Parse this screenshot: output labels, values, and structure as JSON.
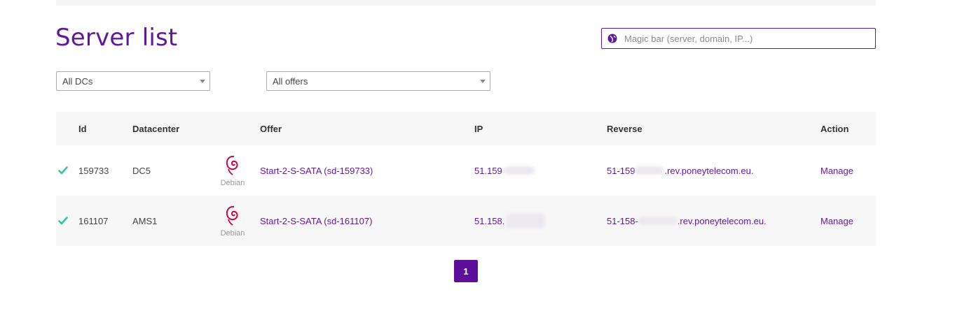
{
  "page": {
    "title": "Server list"
  },
  "magic_bar": {
    "placeholder": "Magic bar (server, domain, IP...)"
  },
  "filters": {
    "datacenter": "All DCs",
    "offer": "All offers"
  },
  "table": {
    "headers": {
      "id": "Id",
      "datacenter": "Datacenter",
      "offer": "Offer",
      "ip": "IP",
      "reverse": "Reverse",
      "action": "Action"
    },
    "rows": [
      {
        "id": "159733",
        "datacenter": "DC5",
        "os": "Debian",
        "offer": "Start-2-S-SATA (sd-159733)",
        "ip": "51.159",
        "reverse_prefix": "51-159",
        "reverse_suffix": ".rev.poneytelecom.eu.",
        "action": "Manage",
        "status": "ok"
      },
      {
        "id": "161107",
        "datacenter": "AMS1",
        "os": "Debian",
        "offer": "Start-2-S-SATA (sd-161107)",
        "ip": "51.158.",
        "reverse_prefix": "51-158-",
        "reverse_suffix": ".rev.poneytelecom.eu.",
        "action": "Manage",
        "status": "ok"
      }
    ]
  },
  "pagination": {
    "current": "1"
  },
  "colors": {
    "brand": "#5e1899",
    "check": "#2dc7a4",
    "debian": "#c7054d"
  },
  "icons": {
    "magic_bar": "globe-icon",
    "status": "check-icon",
    "os": "debian-logo-icon"
  }
}
